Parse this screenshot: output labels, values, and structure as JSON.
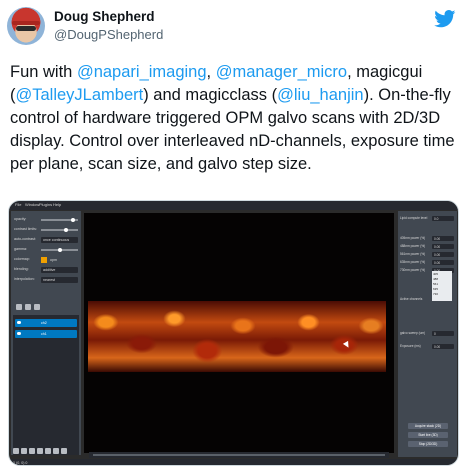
{
  "author": {
    "name": "Doug Shepherd",
    "handle": "@DougPShepherd"
  },
  "tweet": {
    "segments": [
      {
        "text": "Fun with ",
        "mention": false
      },
      {
        "text": "@napari_imaging",
        "mention": true
      },
      {
        "text": ", ",
        "mention": false
      },
      {
        "text": "@manager_micro",
        "mention": true
      },
      {
        "text": ", magicgui (",
        "mention": false
      },
      {
        "text": "@TalleyJLambert",
        "mention": true
      },
      {
        "text": ") and magicclass (",
        "mention": false
      },
      {
        "text": "@liu_hanjin",
        "mention": true
      },
      {
        "text": "). On-the-fly control of hardware triggered OPM galvo scans with 2D/3D display. Control over interleaved nD-channels, exposure time per plane, scan size, and galvo step size.",
        "mention": false
      }
    ]
  },
  "brand": {
    "accent": "#1d9bf0",
    "text": "#0f1419",
    "muted": "#536471"
  },
  "icons": {
    "logo": "twitter-bird-icon"
  },
  "screenshot": {
    "menu": [
      "File",
      "Window",
      "Plugins",
      "Help"
    ],
    "layer_controls": [
      {
        "label": "opacity:",
        "kind": "slider",
        "level": 0.9
      },
      {
        "label": "contrast limits:",
        "kind": "slider",
        "level": 0.7
      },
      {
        "label": "auto-contrast:",
        "kind": "box",
        "value": "once   continuous"
      },
      {
        "label": "gamma:",
        "kind": "slider",
        "level": 0.5
      },
      {
        "label": "colormap:",
        "kind": "swatch",
        "value": "opm"
      },
      {
        "label": "blending:",
        "kind": "box",
        "value": "additive"
      },
      {
        "label": "interpolation:",
        "kind": "box",
        "value": "nearest"
      }
    ],
    "layers": [
      "ch2",
      "ch1"
    ],
    "right_controls": [
      {
        "label": "Lipid compute level",
        "value": "0.0"
      },
      {
        "label": "405nm power (%)",
        "value": "0.00"
      },
      {
        "label": "488nm power (%)",
        "value": "0.00"
      },
      {
        "label": "561nm power (%)",
        "value": "0.00"
      },
      {
        "label": "635nm power (%)",
        "value": "0.00"
      },
      {
        "label": "730nm power (%)",
        "value": "0.00"
      }
    ],
    "active_channels_label": "Active channels",
    "active_channels": [
      "405",
      "488",
      "561",
      "635",
      "730"
    ],
    "galvo_label": "galvo sweep (um)",
    "galvo_value": "0",
    "exposure_label": "Exposure (ms)",
    "exposure_value": "0.00",
    "buttons": [
      "Acquire stack (2D)",
      "Start live (3D)",
      "Stop (2D/3D)"
    ],
    "status": "0 (0, 0) 0"
  }
}
